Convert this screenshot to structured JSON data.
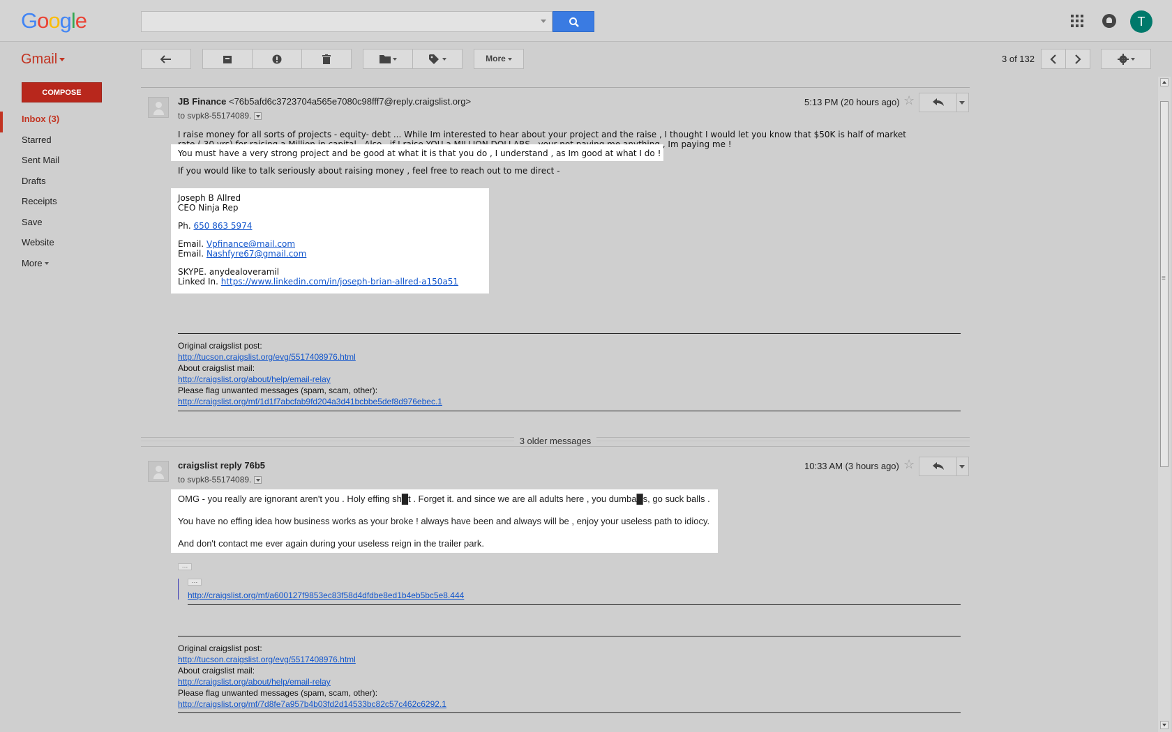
{
  "header": {
    "logo": "Google",
    "search_placeholder": "",
    "avatar_letter": "T"
  },
  "toolbar": {
    "app_label": "Gmail",
    "more_label": "More",
    "pager": "3 of 132"
  },
  "sidebar": {
    "compose_label": "COMPOSE",
    "items": [
      {
        "label": "Inbox (3)"
      },
      {
        "label": "Starred"
      },
      {
        "label": "Sent Mail"
      },
      {
        "label": "Drafts"
      },
      {
        "label": "Receipts"
      },
      {
        "label": "Save"
      },
      {
        "label": "Website"
      },
      {
        "label": "More"
      }
    ]
  },
  "message1": {
    "sender_name": "JB Finance",
    "sender_email": "<76b5afd6c3723704a565e7080c98fff7@reply.craigslist.org>",
    "to": "to svpk8-55174089.",
    "time": "5:13 PM (20 hours ago)",
    "para1": "I raise money for all sorts of projects - equity- debt ... While Im interested to hear about your project and the raise , I thought I would let you know that $50K is half of market",
    "para1b": "rate ( 30 yrs) for raising a Million in capital . Also , if I raise YOU a MILLION DOLLARS , your not paying me anything , Im paying me !",
    "para2": "You must have a very strong project and be good at what it is that you do , I understand , as Im good at what I do !",
    "para3": "If you would like to talk seriously about raising money , feel free to reach out to me direct -",
    "sig_name": "Joseph B Allred",
    "sig_title": "CEO Ninja Rep",
    "sig_phone_label": "Ph.",
    "sig_phone": "650 863 5974",
    "sig_email_label": "Email.",
    "sig_email1": "Vpfinance@mail.com",
    "sig_email2": "Nashfyre67@gmail.com",
    "sig_skype": "SKYPE. anydealoveramil",
    "sig_linkedin_label": "Linked In.",
    "sig_linkedin": "https://www.linkedin.com/in/joseph-brian-allred-a150a51",
    "cl_post_label": "Original craigslist post:",
    "cl_post_link": "http://tucson.craigslist.org/evg/5517408976.html",
    "cl_about_label": "About craigslist mail:",
    "cl_about_link": "http://craigslist.org/about/help/email-relay",
    "cl_flag_label": "Please flag unwanted messages (spam, scam, other):",
    "cl_flag_link": "http://craigslist.org/mf/1d1f7abcfab9fd204a3d41bcbbe5def8d976ebec.1"
  },
  "older_messages": "3 older messages",
  "message2": {
    "sender_name": "craigslist reply 76b5",
    "to": "to svpk8-55174089.",
    "time": "10:33 AM (3 hours ago)",
    "line1": "OMG - you really are ignorant aren't you . Holy effing sh█t . Forget it. and since we are all adults here , you dumba█s, go suck balls .",
    "line2": "You have no effing idea how business works as your broke ! always have been and always will be , enjoy your useless path to idiocy.",
    "line3": "And don't contact me ever again during your useless reign in the trailer park.",
    "quoted_link": "http://craigslist.org/mf/a600127f9853ec83f58d4dfdbe8ed1b4eb5bc5e8.444",
    "cl_post_label": "Original craigslist post:",
    "cl_post_link": "http://tucson.craigslist.org/evg/5517408976.html",
    "cl_about_label": "About craigslist mail:",
    "cl_about_link": "http://craigslist.org/about/help/email-relay",
    "cl_flag_label": "Please flag unwanted messages (spam, scam, other):",
    "cl_flag_link": "http://craigslist.org/mf/7d8fe7a957b4b03fd2d14533bc82c57c462c6292.1"
  },
  "colors": {
    "accent_red": "#c23321",
    "search_blue": "#3a7be2",
    "avatar_teal": "#00796b"
  }
}
